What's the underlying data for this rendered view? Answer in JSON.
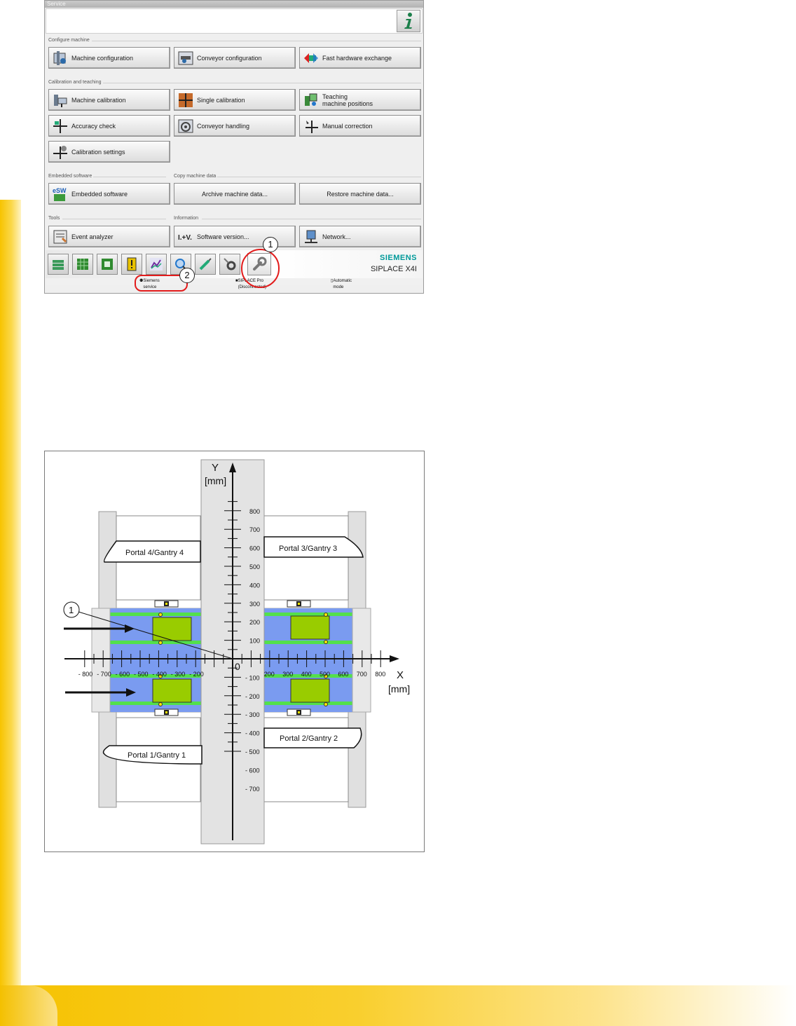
{
  "window": {
    "title": "Service"
  },
  "sections": {
    "configure": "Configure machine",
    "calibration": "Calibration and teaching",
    "embedded": "Embedded software",
    "copy": "Copy machine data",
    "tools": "Tools",
    "information": "Information"
  },
  "buttons": {
    "machine_configuration": "Machine configuration",
    "conveyor_configuration": "Conveyor configuration",
    "fast_hardware_exchange": "Fast hardware exchange",
    "machine_calibration": "Machine calibration",
    "single_calibration": "Single calibration",
    "teaching_line1": "Teaching",
    "teaching_line2": "machine positions",
    "accuracy_check": "Accuracy check",
    "conveyor_handling": "Conveyor handling",
    "manual_correction": "Manual correction",
    "calibration_settings": "Calibration settings",
    "embedded_software": "Embedded software",
    "archive_machine_data": "Archive machine data...",
    "restore_machine_data": "Restore machine data...",
    "event_analyzer": "Event analyzer",
    "software_version": "Software version...",
    "network": "Network..."
  },
  "brand": {
    "company": "SIEMENS",
    "product": "SIPLACE X4I"
  },
  "status_bar": {
    "user": "Siemens service",
    "connection": "SIPLACE Pro (Disconnected)",
    "mode": "Automatic mode"
  },
  "callouts": {
    "one": "1",
    "two": "2"
  },
  "diagram": {
    "y_axis_label": "Y",
    "y_unit": "[mm]",
    "x_axis_label": "X",
    "x_unit": "[mm]",
    "origin": "0",
    "callout": "1",
    "portals": {
      "p4": "Portal 4/Gantry 4",
      "p3": "Portal 3/Gantry 3",
      "p1": "Portal 1/Gantry 1",
      "p2": "Portal 2/Gantry 2"
    },
    "y_ticks_pos": [
      "800",
      "700",
      "600",
      "500",
      "400",
      "300",
      "200",
      "100"
    ],
    "y_ticks_neg": [
      "- 100",
      "- 200",
      "- 300",
      "- 400",
      "- 500",
      "- 600",
      "- 700"
    ],
    "x_ticks_neg": [
      "- 800",
      "- 700",
      "- 600",
      "- 500",
      "- 400",
      "- 300",
      "- 200"
    ],
    "x_ticks_pos": [
      "200",
      "300",
      "400",
      "500",
      "600",
      "700",
      "800"
    ]
  },
  "colors": {
    "accent_red": "#e21b1b",
    "siemens_teal": "#009999",
    "conveyor_blue": "#7a9bf0",
    "conveyor_green": "#53e04b",
    "board_green": "#99cc00",
    "sidebar_yellow": "#f7c300"
  }
}
